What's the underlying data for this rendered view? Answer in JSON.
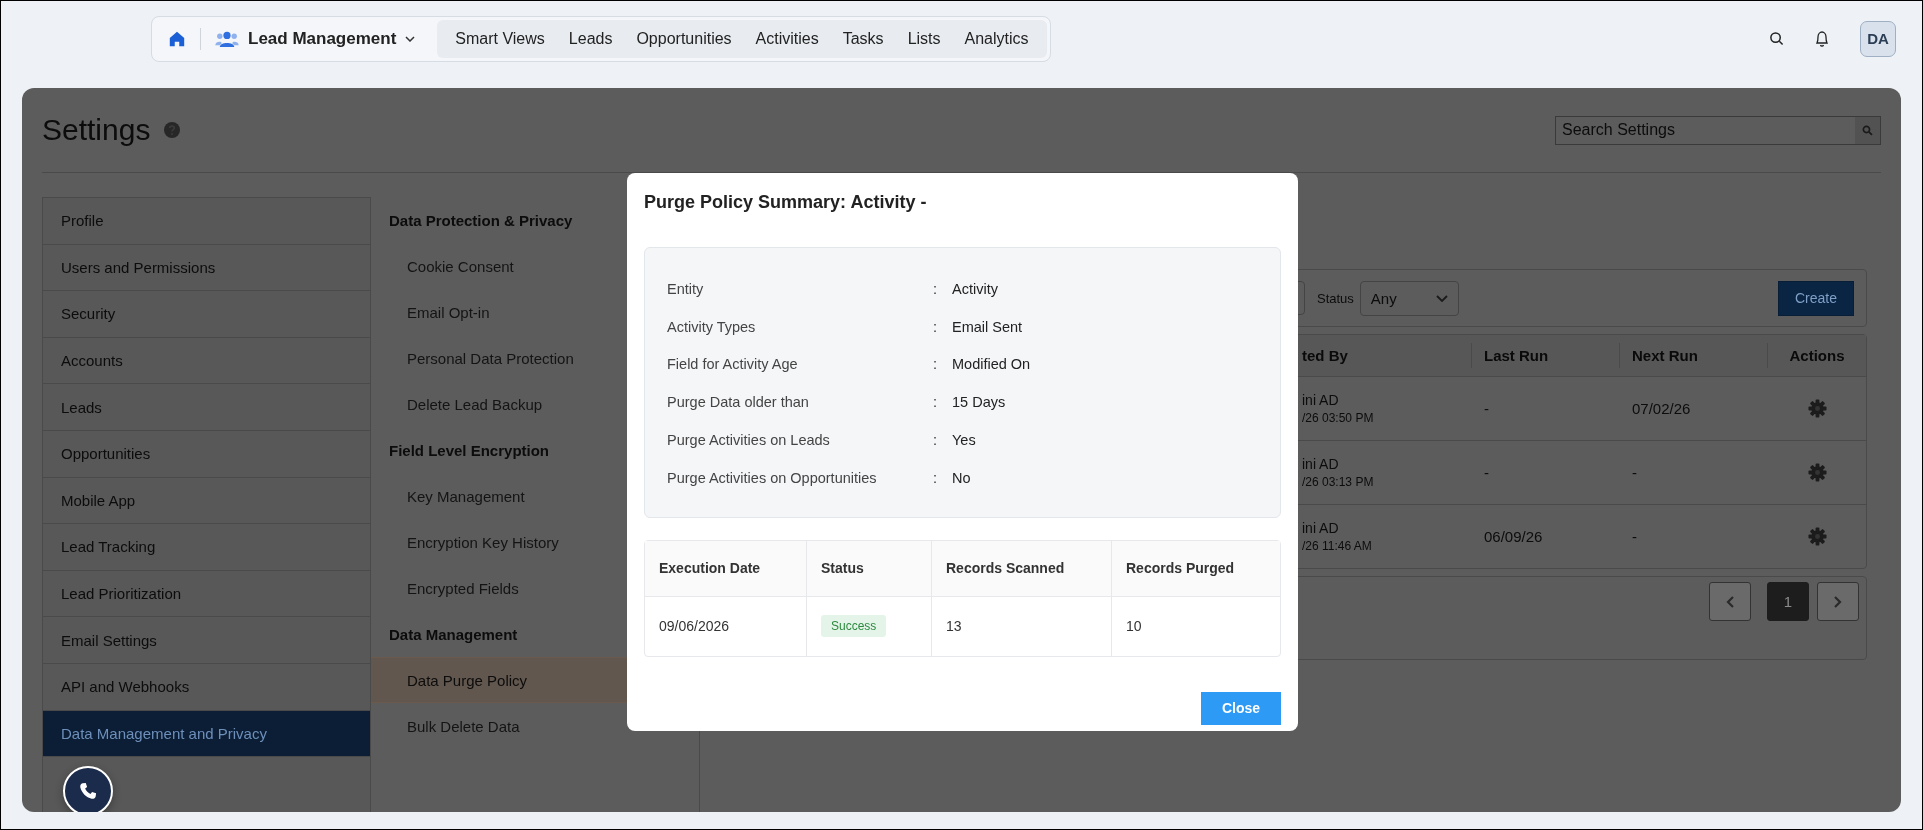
{
  "nav": {
    "app_name": "Lead Management",
    "tabs": [
      "Smart Views",
      "Leads",
      "Opportunities",
      "Activities",
      "Tasks",
      "Lists",
      "Analytics"
    ],
    "avatar": "DA"
  },
  "settings": {
    "title": "Settings",
    "search": {
      "placeholder": "Search Settings"
    }
  },
  "sidebar": {
    "items": [
      {
        "label": "Profile",
        "selected": false
      },
      {
        "label": "Users and Permissions",
        "selected": false
      },
      {
        "label": "Security",
        "selected": false
      },
      {
        "label": "Accounts",
        "selected": false
      },
      {
        "label": "Leads",
        "selected": false
      },
      {
        "label": "Opportunities",
        "selected": false
      },
      {
        "label": "Mobile App",
        "selected": false
      },
      {
        "label": "Lead Tracking",
        "selected": false
      },
      {
        "label": "Lead Prioritization",
        "selected": false
      },
      {
        "label": "Email Settings",
        "selected": false
      },
      {
        "label": "API and Webhooks",
        "selected": false
      },
      {
        "label": "Data Management and Privacy",
        "selected": true
      }
    ]
  },
  "subnav": {
    "sections": [
      {
        "heading": "Data Protection & Privacy",
        "items": [
          {
            "label": "Cookie Consent",
            "selected": false
          },
          {
            "label": "Email Opt-in",
            "selected": false
          },
          {
            "label": "Personal Data Protection",
            "selected": false
          },
          {
            "label": "Delete Lead Backup",
            "selected": false
          }
        ]
      },
      {
        "heading": "Field Level Encryption",
        "items": [
          {
            "label": "Key Management",
            "selected": false
          },
          {
            "label": "Encryption Key History",
            "selected": false
          },
          {
            "label": "Encrypted Fields",
            "selected": false
          }
        ]
      },
      {
        "heading": "Data Management",
        "items": [
          {
            "label": "Data Purge Policy",
            "selected": true
          },
          {
            "label": "Bulk Delete Data",
            "selected": false
          }
        ]
      }
    ]
  },
  "policy_list": {
    "status_filter": {
      "label": "Status",
      "value": "Any"
    },
    "create_button": "Create",
    "columns": [
      "ted By",
      "Last Run",
      "Next Run",
      "Actions"
    ],
    "rows": [
      {
        "created_by": "ini AD",
        "created_on": "/26 03:50 PM",
        "last_run": "-",
        "next_run": "07/02/26"
      },
      {
        "created_by": "ini AD",
        "created_on": "/26 03:13 PM",
        "last_run": "-",
        "next_run": "-"
      },
      {
        "created_by": "ini AD",
        "created_on": "/26 11:46 AM",
        "last_run": "06/09/26",
        "next_run": "-"
      }
    ],
    "pages": [
      {
        "label": "1",
        "selected": true
      }
    ]
  },
  "modal": {
    "title": "Purge Policy Summary: Activity -",
    "summary": [
      {
        "label": "Entity",
        "separator": ":",
        "value": "Activity"
      },
      {
        "label": "Activity Types",
        "separator": ":",
        "value": "Email Sent"
      },
      {
        "label": "Field for Activity Age",
        "separator": ":",
        "value": "Modified On"
      },
      {
        "label": "Purge Data older than",
        "separator": ":",
        "value": "15 Days"
      },
      {
        "label": "Purge Activities on Leads",
        "separator": ":",
        "value": "Yes"
      },
      {
        "label": "Purge Activities on Opportunities",
        "separator": ":",
        "value": "No"
      }
    ],
    "table": {
      "columns": [
        "Execution Date",
        "Status",
        "Records Scanned",
        "Records Purged"
      ],
      "rows": [
        {
          "execution_date": "09/06/2026",
          "status": {
            "text": "Success",
            "kind": "success"
          },
          "records_scanned": "13",
          "records_purged": "10"
        }
      ]
    },
    "close_button": "Close"
  }
}
